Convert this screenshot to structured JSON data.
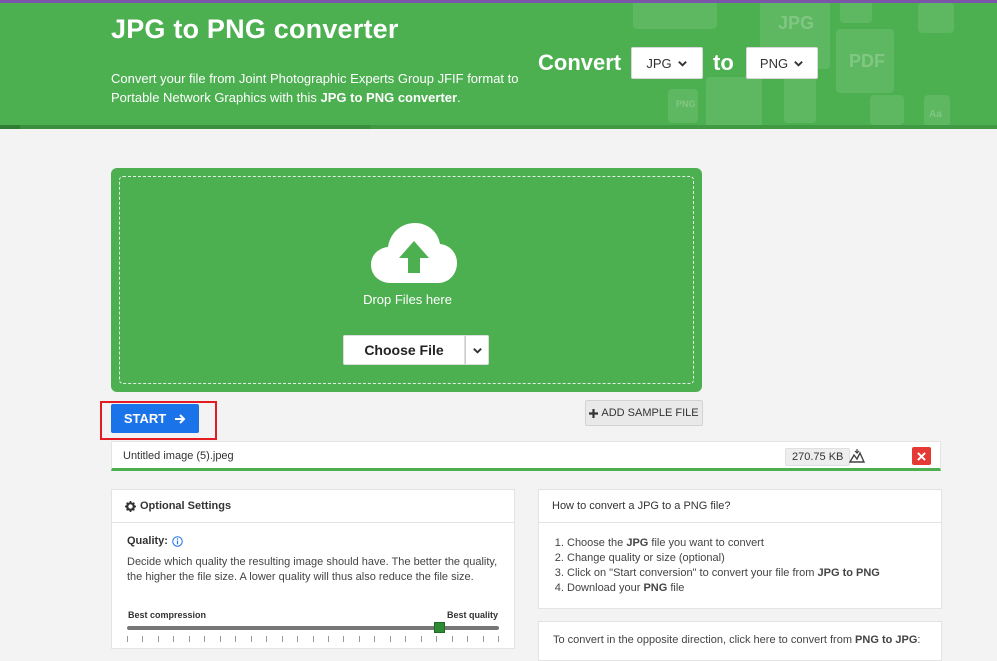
{
  "header": {
    "title": "JPG to PNG converter",
    "subtitle_pre": "Convert your file from Joint Photographic Experts Group JFIF format to Portable Network Graphics with this ",
    "subtitle_bold": "JPG to PNG converter",
    "subtitle_post": ".",
    "convert_label": "Convert",
    "to_label": "to",
    "from_format": "JPG",
    "to_format": "PNG",
    "deco_labels": [
      "JPG",
      "PDF",
      "PNG",
      "Aa"
    ]
  },
  "upload": {
    "drop_text": "Drop Files here",
    "choose_label": "Choose File"
  },
  "actions": {
    "start_label": "START",
    "sample_label": "ADD SAMPLE FILE"
  },
  "file": {
    "name": "Untitled image (5).jpeg",
    "size": "270.75 KB"
  },
  "settings": {
    "heading": "Optional Settings",
    "quality_label": "Quality:",
    "quality_description": "Decide which quality the resulting image should have. The better the quality, the higher the file size. A lower quality will thus also reduce the file size.",
    "slider_min_label": "Best compression",
    "slider_max_label": "Best quality",
    "quality_value_fraction": 0.84
  },
  "howto": {
    "heading": "How to convert a JPG to a PNG file?",
    "steps": [
      {
        "pre": "Choose the ",
        "bold": "JPG",
        "post": " file you want to convert"
      },
      {
        "pre": "Change quality or size (optional)",
        "bold": "",
        "post": ""
      },
      {
        "pre": "Click on \"Start conversion\" to convert your file from ",
        "bold": "JPG to PNG",
        "post": ""
      },
      {
        "pre": "Download your ",
        "bold": "PNG",
        "post": " file"
      }
    ]
  },
  "opposite": {
    "text_pre": "To convert in the opposite direction, click here to convert from ",
    "text_bold": "PNG to JPG",
    "text_post": ":"
  },
  "colors": {
    "brand_green": "#4caf50",
    "start_blue": "#1a73e8",
    "highlight_red": "#e31b23",
    "delete_red": "#e53935",
    "top_line": "#7a55a8"
  }
}
